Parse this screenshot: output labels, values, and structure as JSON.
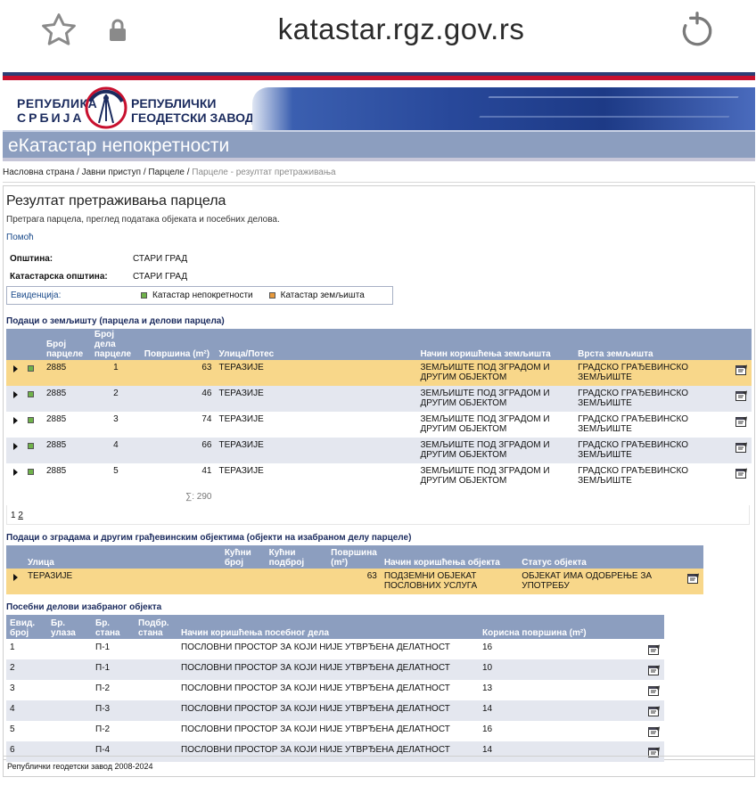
{
  "browser": {
    "url": "katastar.rgz.gov.rs"
  },
  "header": {
    "logo_left_line1": "РЕПУБЛИКА",
    "logo_left_line2": "СРБИЈА",
    "logo_right_line1": "РЕПУБЛИЧКИ",
    "logo_right_line2": "ГЕОДЕТСКИ ЗАВОД",
    "app_title": "еКатастар непокретности"
  },
  "breadcrumb": {
    "home": "Насловна страна",
    "public": "Јавни приступ",
    "parcels": "Парцеле",
    "current": "Парцеле - резултат претраживања",
    "sep": " / "
  },
  "page": {
    "title": "Резултат претраживања парцела",
    "subtitle": "Претрага парцела, преглед података објеката и посебних делова.",
    "help": "Помоћ"
  },
  "info": {
    "municipality_label": "Општина:",
    "municipality_value": "СТАРИ ГРАД",
    "cadastral_label": "Катастарска општина:",
    "cadastral_value": "СТАРИ ГРАД",
    "records_label": "Евиденција:",
    "legend_real_estate": "Катастар непокретности",
    "legend_land": "Катастар земљишта"
  },
  "parcels": {
    "section_title": "Подаци о земљишту (парцела и делови парцела)",
    "headers": [
      "Број парцеле",
      "Број дела парцеле",
      "Површина (m²)",
      "Улица/Потес",
      "Начин коришћења земљишта",
      "Врста земљишта"
    ],
    "rows": [
      {
        "parcel": "2885",
        "part": "1",
        "area": "63",
        "street": "ТЕРАЗИЈЕ",
        "usage": "ЗЕМЉИШТЕ ПОД ЗГРАДОМ И ДРУГИМ ОБЈЕКТОМ",
        "type": "ГРАДСКО ГРАЂЕВИНСКО ЗЕМЉИШТЕ"
      },
      {
        "parcel": "2885",
        "part": "2",
        "area": "46",
        "street": "ТЕРАЗИЈЕ",
        "usage": "ЗЕМЉИШТЕ ПОД ЗГРАДОМ И ДРУГИМ ОБЈЕКТОМ",
        "type": "ГРАДСКО ГРАЂЕВИНСКО ЗЕМЉИШТЕ"
      },
      {
        "parcel": "2885",
        "part": "3",
        "area": "74",
        "street": "ТЕРАЗИЈЕ",
        "usage": "ЗЕМЉИШТЕ ПОД ЗГРАДОМ И ДРУГИМ ОБЈЕКТОМ",
        "type": "ГРАДСКО ГРАЂЕВИНСКО ЗЕМЉИШТЕ"
      },
      {
        "parcel": "2885",
        "part": "4",
        "area": "66",
        "street": "ТЕРАЗИЈЕ",
        "usage": "ЗЕМЉИШТЕ ПОД ЗГРАДОМ И ДРУГИМ ОБЈЕКТОМ",
        "type": "ГРАДСКО ГРАЂЕВИНСКО ЗЕМЉИШТЕ"
      },
      {
        "parcel": "2885",
        "part": "5",
        "area": "41",
        "street": "ТЕРАЗИЈЕ",
        "usage": "ЗЕМЉИШТЕ ПОД ЗГРАДОМ И ДРУГИМ ОБЈЕКТОМ",
        "type": "ГРАДСКО ГРАЂЕВИНСКО ЗЕМЉИШТЕ"
      }
    ],
    "sum": "∑: 290",
    "pages": [
      "1",
      "2"
    ]
  },
  "buildings": {
    "section_title": "Подаци о зградама и другим грађевинским објектима (објекти на изабраном делу парцеле)",
    "headers": [
      "Улица",
      "Кућни број",
      "Кућни подброј",
      "Површина (m²)",
      "Начин коришћења објекта",
      "Статус објекта"
    ],
    "rows": [
      {
        "street": "ТЕРАЗИЈЕ",
        "house_no": "",
        "house_sub": "",
        "area": "63",
        "usage": "ПОДЗЕМНИ ОБЈЕКАТ ПОСЛОВНИХ УСЛУГА",
        "status": "ОБЈЕКАТ ИМА ОДОБРЕЊЕ ЗА УПОТРЕБУ"
      }
    ]
  },
  "units": {
    "section_title": "Посебни делови изабраног објекта",
    "headers": [
      "Евид. број",
      "Бр. улаза",
      "Бр. стана",
      "Подбр. стана",
      "Начин коришћења посебног дела",
      "Корисна површина (m²)"
    ],
    "rows": [
      {
        "id": "1",
        "entrance": "",
        "apt": "П-1",
        "sub": "",
        "usage": "ПОСЛОВНИ ПРОСТОР ЗА КОЈИ НИЈЕ УТВРЂЕНА ДЕЛАТНОСТ",
        "area": "16"
      },
      {
        "id": "2",
        "entrance": "",
        "apt": "П-1",
        "sub": "",
        "usage": "ПОСЛОВНИ ПРОСТОР ЗА КОЈИ НИЈЕ УТВРЂЕНА ДЕЛАТНОСТ",
        "area": "10"
      },
      {
        "id": "3",
        "entrance": "",
        "apt": "П-2",
        "sub": "",
        "usage": "ПОСЛОВНИ ПРОСТОР ЗА КОЈИ НИЈЕ УТВРЂЕНА ДЕЛАТНОСТ",
        "area": "13"
      },
      {
        "id": "4",
        "entrance": "",
        "apt": "П-3",
        "sub": "",
        "usage": "ПОСЛОВНИ ПРОСТОР ЗА КОЈИ НИЈЕ УТВРЂЕНА ДЕЛАТНОСТ",
        "area": "14"
      },
      {
        "id": "5",
        "entrance": "",
        "apt": "П-2",
        "sub": "",
        "usage": "ПОСЛОВНИ ПРОСТОР ЗА КОЈИ НИЈЕ УТВРЂЕНА ДЕЛАТНОСТ",
        "area": "16"
      },
      {
        "id": "6",
        "entrance": "",
        "apt": "П-4",
        "sub": "",
        "usage": "ПОСЛОВНИ ПРОСТОР ЗА КОЈИ НИЈЕ УТВРЂЕНА ДЕЛАТНОСТ",
        "area": "14"
      }
    ]
  },
  "footer": {
    "text": "Републички геодетски завод 2008-2024"
  },
  "colors": {
    "header_blue": "#8c9ebf",
    "selected_row": "#f8d78a",
    "alt_row": "#e4e7ef",
    "brand_navy": "#1b2b5e",
    "brand_red": "#c8102e"
  }
}
